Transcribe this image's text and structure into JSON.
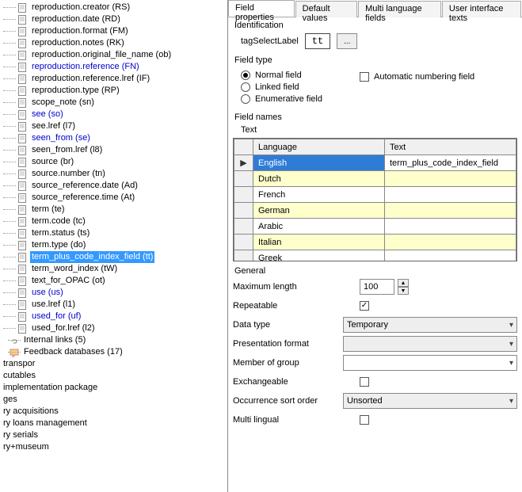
{
  "tree": {
    "items": [
      {
        "label": "reproduction.creator (RS)",
        "blue": false
      },
      {
        "label": "reproduction.date (RD)",
        "blue": false
      },
      {
        "label": "reproduction.format (FM)",
        "blue": false
      },
      {
        "label": "reproduction.notes (RK)",
        "blue": false
      },
      {
        "label": "reproduction.original_file_name (ob)",
        "blue": false
      },
      {
        "label": "reproduction.reference (FN)",
        "blue": true
      },
      {
        "label": "reproduction.reference.lref (IF)",
        "blue": false
      },
      {
        "label": "reproduction.type (RP)",
        "blue": false
      },
      {
        "label": "scope_note (sn)",
        "blue": false
      },
      {
        "label": "see (so)",
        "blue": true
      },
      {
        "label": "see.lref (l7)",
        "blue": false
      },
      {
        "label": "seen_from (se)",
        "blue": true
      },
      {
        "label": "seen_from.lref (l8)",
        "blue": false
      },
      {
        "label": "source (br)",
        "blue": false
      },
      {
        "label": "source.number (tn)",
        "blue": false
      },
      {
        "label": "source_reference.date (Ad)",
        "blue": false
      },
      {
        "label": "source_reference.time (At)",
        "blue": false
      },
      {
        "label": "term (te)",
        "blue": false
      },
      {
        "label": "term.code (tc)",
        "blue": false
      },
      {
        "label": "term.status (ts)",
        "blue": false
      },
      {
        "label": "term.type (do)",
        "blue": false
      },
      {
        "label": "term_plus_code_index_field (tt)",
        "blue": false,
        "selected": true
      },
      {
        "label": "term_word_index (tW)",
        "blue": false
      },
      {
        "label": "text_for_OPAC (ot)",
        "blue": false
      },
      {
        "label": "use (us)",
        "blue": true
      },
      {
        "label": "use.lref (l1)",
        "blue": false
      },
      {
        "label": "used_for (uf)",
        "blue": true
      },
      {
        "label": "used_for.lref (l2)",
        "blue": false
      }
    ],
    "extras": [
      {
        "icon": "link",
        "label": "Internal links (5)"
      },
      {
        "icon": "feedback",
        "label": "Feedback databases (17)"
      }
    ],
    "roots": [
      "transpor",
      "cutables",
      "implementation package",
      "ges",
      "ry acquisitions",
      "ry loans management",
      "ry serials",
      "ry+museum"
    ]
  },
  "tabs": {
    "items": [
      "Field properties",
      "Default values",
      "Multi language fields",
      "User interface texts"
    ],
    "active": 0
  },
  "identification": {
    "group_label": "Identification",
    "label": "tagSelectLabel",
    "value": "tt",
    "ellipsis": "..."
  },
  "fieldtype": {
    "group_label": "Field type",
    "options": [
      "Normal field",
      "Linked field",
      "Enumerative field"
    ],
    "selected": 0,
    "auto_label": "Automatic numbering field",
    "auto_checked": false
  },
  "fieldnames": {
    "group_label": "Field names",
    "sub_label": "Text",
    "columns": [
      "Language",
      "Text"
    ],
    "row_marker": "▶",
    "rows": [
      {
        "lang": "English",
        "text": "term_plus_code_index_field",
        "selected": true
      },
      {
        "lang": "Dutch",
        "text": "",
        "alt": true
      },
      {
        "lang": "French",
        "text": ""
      },
      {
        "lang": "German",
        "text": "",
        "alt": true
      },
      {
        "lang": "Arabic",
        "text": ""
      },
      {
        "lang": "Italian",
        "text": "",
        "alt": true
      },
      {
        "lang": "Greek",
        "text": ""
      }
    ]
  },
  "general": {
    "group_label": "General",
    "rows": {
      "maxlen": {
        "label": "Maximum length",
        "value": "100"
      },
      "repeat": {
        "label": "Repeatable",
        "checked": true
      },
      "dtype": {
        "label": "Data type",
        "value": "Temporary"
      },
      "pformat": {
        "label": "Presentation format",
        "value": ""
      },
      "member": {
        "label": "Member of group",
        "value": ""
      },
      "exch": {
        "label": "Exchangeable",
        "checked": false
      },
      "sort": {
        "label": "Occurrence sort order",
        "value": "Unsorted"
      },
      "multi": {
        "label": "Multi lingual",
        "checked": false
      }
    }
  }
}
